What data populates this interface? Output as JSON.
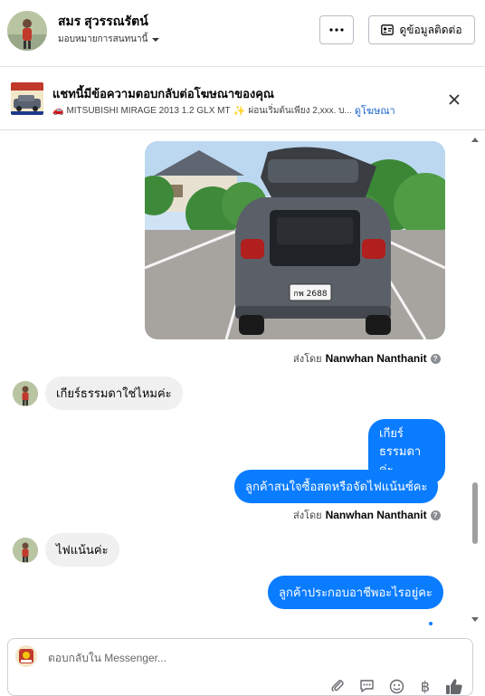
{
  "header": {
    "name": "สมร สุวรรณรัตน์",
    "assign_label": "มอบหมายการสนทนานี้",
    "more_label": "···",
    "contact_button": "ดูข้อมูลติดต่อ"
  },
  "ad_banner": {
    "title": "แชทนี้มีข้อความตอบกลับต่อโฆษณาของคุณ",
    "subtitle": "MITSUBISHI MIRAGE 2013 1.2 GLX MT",
    "subtitle_tail": "ผ่อนเริ่มต้นเพียง 2,xxx. บ...",
    "link": "ดูโฆษณา",
    "thumb_text": "1 ล้อ"
  },
  "messages": [
    {
      "type": "image",
      "direction": "out",
      "plate_text": "กพ 2688"
    },
    {
      "type": "meta",
      "prefix": "ส่งโดย",
      "sender": "Nanwhan Nanthanit"
    },
    {
      "type": "text",
      "direction": "in",
      "text": "เกียร์ธรรมดาใช่ไหมค่ะ"
    },
    {
      "type": "text",
      "direction": "out",
      "lines": [
        "เกียร์",
        "ธรรมดา ค่ะ"
      ]
    },
    {
      "type": "text",
      "direction": "out",
      "text": "ลูกค้าสนใจซื้อสดหรือจัดไฟแน้นซ์คะ"
    },
    {
      "type": "meta",
      "prefix": "ส่งโดย",
      "sender": "Nanwhan Nanthanit"
    },
    {
      "type": "text",
      "direction": "in",
      "text": "ไฟแน้นค่ะ"
    },
    {
      "type": "text",
      "direction": "out",
      "text": "ลูกค้าประกอบอาชีพอะไรอยู่คะ"
    }
  ],
  "composer": {
    "placeholder": "ตอบกลับใน Messenger..."
  },
  "icons": {
    "attach": "paperclip-icon",
    "saved_replies": "chat-bubble-icon",
    "emoji": "smiley-icon",
    "payment": "baht-icon",
    "like": "thumbs-up-icon",
    "currency_symbol": "฿"
  },
  "colors": {
    "outgoing_bubble": "#0a7cff",
    "incoming_bubble": "#f0f0f0",
    "link": "#1763cf"
  }
}
